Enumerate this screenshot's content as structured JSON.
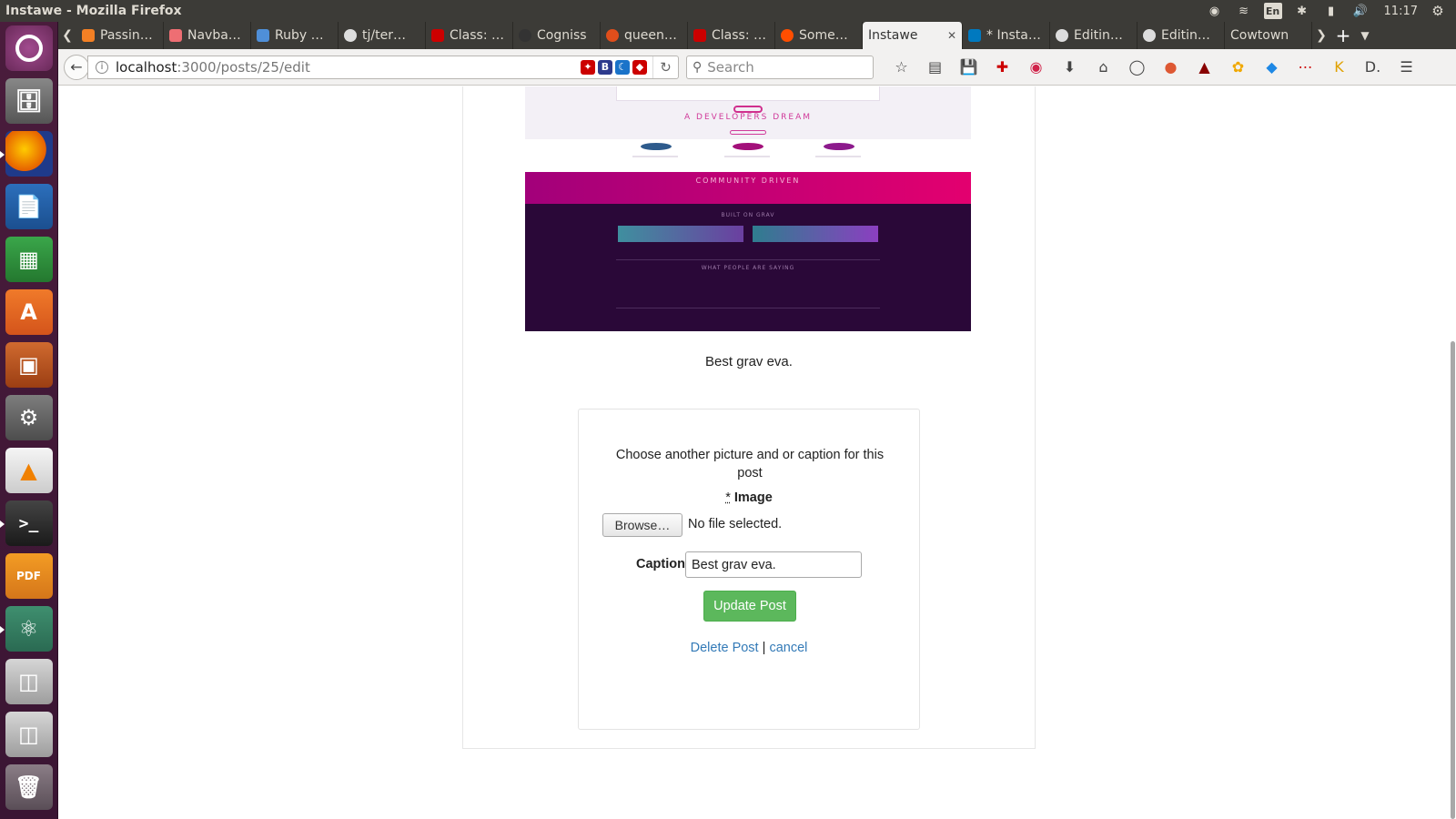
{
  "window": {
    "title": "Instawe - Mozilla Firefox"
  },
  "system": {
    "keyboard": "En",
    "clock": "11:17"
  },
  "tabs": [
    {
      "label": "Passin…",
      "icon": "stackoverflow-icon",
      "color": "#f48024"
    },
    {
      "label": "Navba…",
      "icon": "materialize-icon",
      "color": "#ee6e73"
    },
    {
      "label": "Ruby …",
      "icon": "dots-icon",
      "color": "#4f8fd8"
    },
    {
      "label": "tj/ter…",
      "icon": "github-icon",
      "color": "#dddddd"
    },
    {
      "label": "Class: …",
      "icon": "ruby-icon",
      "color": "#cc0000"
    },
    {
      "label": "Cogniss",
      "icon": "cogniss-icon",
      "color": "#333333"
    },
    {
      "label": "queen…",
      "icon": "queen-icon",
      "color": "#e04e1b"
    },
    {
      "label": "Class: …",
      "icon": "ruby-icon",
      "color": "#cc0000"
    },
    {
      "label": "Some…",
      "icon": "ars-icon",
      "color": "#ff4e00"
    },
    {
      "label": "Instawe",
      "icon": "",
      "color": "#ffffff",
      "active": true
    },
    {
      "label": "* Insta…",
      "icon": "trello-icon",
      "color": "#0079bf"
    },
    {
      "label": "Editin…",
      "icon": "github-icon",
      "color": "#dddddd"
    },
    {
      "label": "Editin…",
      "icon": "github-icon",
      "color": "#dddddd"
    },
    {
      "label": "Cowtown",
      "icon": "",
      "color": "#dddddd"
    }
  ],
  "navbar": {
    "url_host": "localhost",
    "url_path": ":3000/posts/25/edit",
    "search_placeholder": "Search"
  },
  "post": {
    "caption": "Best grav eva.",
    "image_texts": {
      "dream": "A DEVELOPERS DREAM",
      "community": "COMMUNITY DRIVEN",
      "built": "BUILT ON GRAV",
      "people": "WHAT PEOPLE ARE SAYING"
    }
  },
  "form": {
    "intro": "Choose another picture and or caption for this post",
    "required_marker": "*",
    "image_label": "Image",
    "browse_label": "Browse…",
    "file_status": "No file selected.",
    "caption_label": "Caption",
    "caption_value": "Best grav eva.",
    "submit_label": "Update Post",
    "delete_label": "Delete Post",
    "separator": "|",
    "cancel_label": "cancel"
  },
  "colors": {
    "submit_green": "#5cb85c",
    "link_blue": "#337ab7",
    "launcher_purple": "#4a1c3c",
    "panel_dark": "#3c3b37"
  }
}
